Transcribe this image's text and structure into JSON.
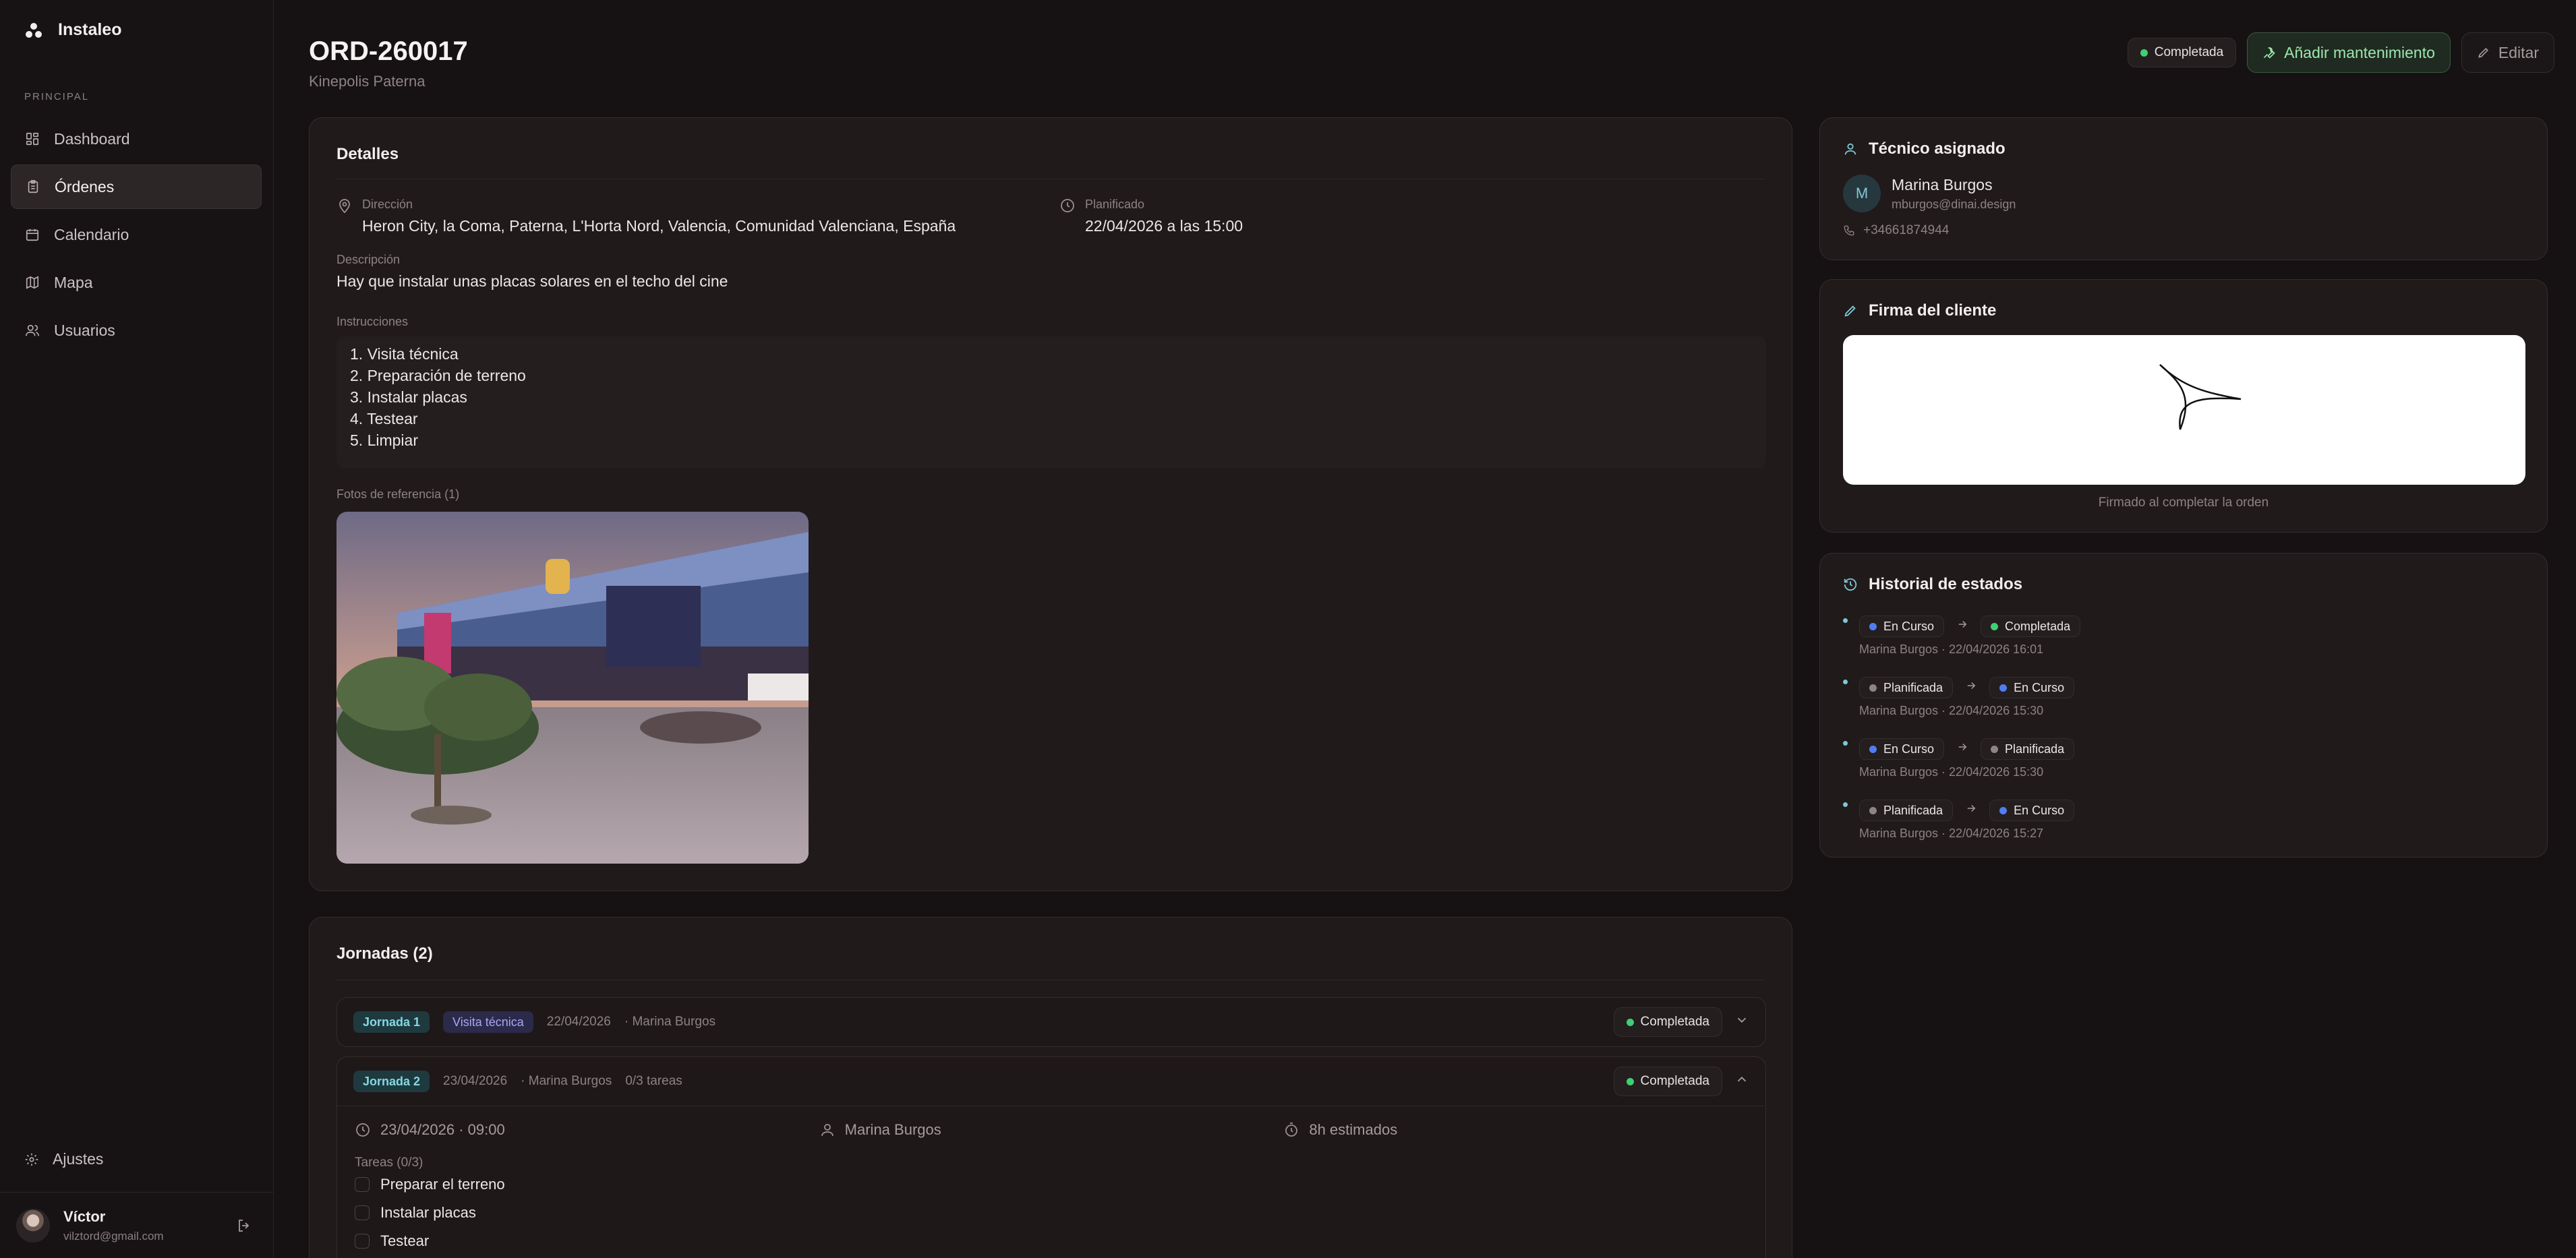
{
  "app": {
    "name": "Instaleo"
  },
  "sidebar": {
    "section_label": "PRINCIPAL",
    "items": [
      {
        "label": "Dashboard",
        "icon": "dashboard-icon"
      },
      {
        "label": "Órdenes",
        "icon": "clipboard-icon",
        "active": true
      },
      {
        "label": "Calendario",
        "icon": "calendar-icon"
      },
      {
        "label": "Mapa",
        "icon": "map-icon"
      },
      {
        "label": "Usuarios",
        "icon": "users-icon"
      }
    ],
    "settings_label": "Ajustes",
    "user": {
      "name": "Víctor",
      "email": "vilztord@gmail.com"
    }
  },
  "header": {
    "title": "ORD-260017",
    "subtitle": "Kinepolis Paterna",
    "status": "Completada",
    "maintenance_label": "Añadir mantenimiento",
    "edit_label": "Editar"
  },
  "details": {
    "title": "Detalles",
    "address_label": "Dirección",
    "address_value": "Heron City, la Coma, Paterna, L'Horta Nord, Valencia, Comunidad Valenciana, España",
    "planned_label": "Planificado",
    "planned_value": "22/04/2026 a las 15:00",
    "description_label": "Descripción",
    "description_value": "Hay que instalar unas placas solares en el techo del cine",
    "instructions_label": "Instrucciones",
    "instructions": [
      "1. Visita técnica",
      "2. Preparación de terreno",
      "3. Instalar placas",
      "4. Testear",
      "5. Limpiar"
    ],
    "photos_label": "Fotos de referencia (1)"
  },
  "jornadas": {
    "title": "Jornadas (2)",
    "items": [
      {
        "tag": "Jornada 1",
        "type": "Visita técnica",
        "date": "22/04/2026",
        "tech": "· Marina Burgos",
        "status": "Completada"
      },
      {
        "tag": "Jornada 2",
        "date": "23/04/2026",
        "tech": "· Marina Burgos",
        "tasks_count": "0/3 tareas",
        "status": "Completada",
        "datetime": "23/04/2026 · 09:00",
        "assignee": "Marina Burgos",
        "estimate": "8h estimados",
        "tasks_label": "Tareas (0/3)",
        "tasks": [
          "Preparar el terreno",
          "Instalar placas",
          "Testear"
        ]
      }
    ]
  },
  "technician": {
    "title": "Técnico asignado",
    "initial": "M",
    "name": "Marina Burgos",
    "email": "mburgos@dinai.design",
    "phone": "+34661874944"
  },
  "signature": {
    "title": "Firma del cliente",
    "caption": "Firmado al completar la orden"
  },
  "history": {
    "title": "Historial de estados",
    "entries": [
      {
        "from": "En Curso",
        "to": "Completada",
        "meta": "Marina Burgos · 22/04/2026 16:01"
      },
      {
        "from": "Planificada",
        "to": "En Curso",
        "meta": "Marina Burgos · 22/04/2026 15:30"
      },
      {
        "from": "En Curso",
        "to": "Planificada",
        "meta": "Marina Burgos · 22/04/2026 15:30"
      },
      {
        "from": "Planificada",
        "to": "En Curso",
        "meta": "Marina Burgos · 22/04/2026 15:27"
      }
    ]
  },
  "colors": {
    "background": "#161213",
    "card": "#201a1b",
    "accent_green": "#9ee7ad",
    "status_green": "#3fcf74",
    "status_blue": "#4f7ef2",
    "status_grey": "#8d8485"
  }
}
